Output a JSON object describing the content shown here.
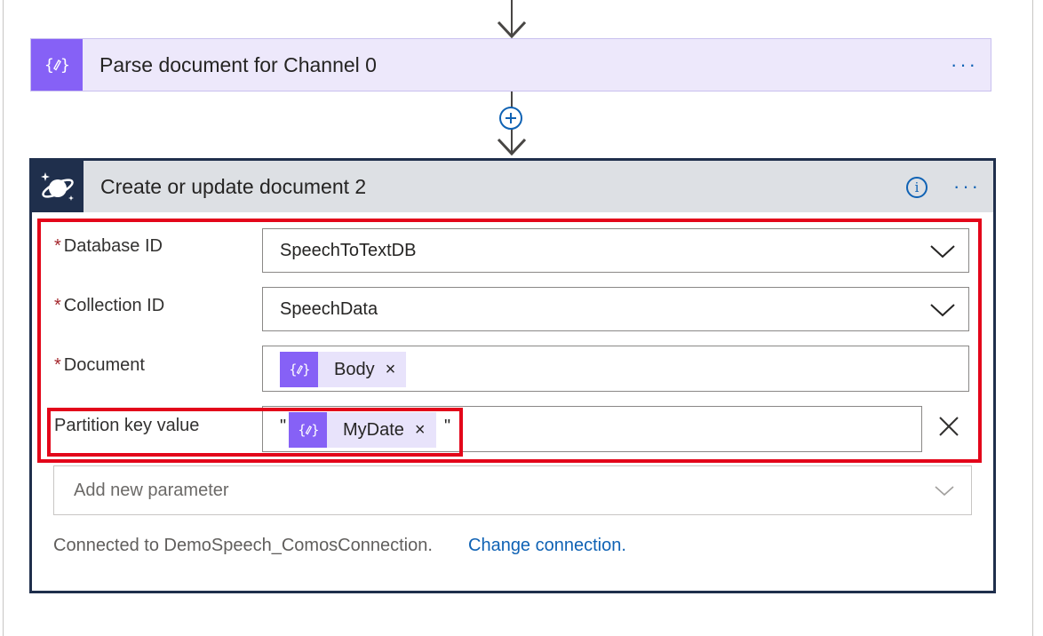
{
  "parse_card": {
    "title": "Parse document for Channel 0",
    "icon": "data-operations-icon",
    "menu_label": "···"
  },
  "create_card": {
    "title": "Create or update document 2",
    "icon": "cosmos-db-planet-icon",
    "info_label": "i",
    "menu_label": "···",
    "required_mark": "*",
    "fields": {
      "database_id": {
        "label": "Database ID",
        "value": "SpeechToTextDB"
      },
      "collection_id": {
        "label": "Collection ID",
        "value": "SpeechData"
      },
      "document": {
        "label": "Document",
        "token": "Body"
      },
      "partition_key": {
        "label": "Partition key value",
        "quote_open": "\"",
        "token": "MyDate",
        "quote_close": "\""
      }
    },
    "token_close": "×",
    "add_parameter_placeholder": "Add new parameter",
    "connected_text": "Connected to DemoSpeech_ComosConnection.",
    "change_connection": "Change connection."
  },
  "colors": {
    "accent": "#0f62b4",
    "parse_icon_bg": "#8661f6",
    "parse_bg": "#ede8fb",
    "create_border": "#1f2f4c",
    "highlight_red": "#e3061a"
  }
}
